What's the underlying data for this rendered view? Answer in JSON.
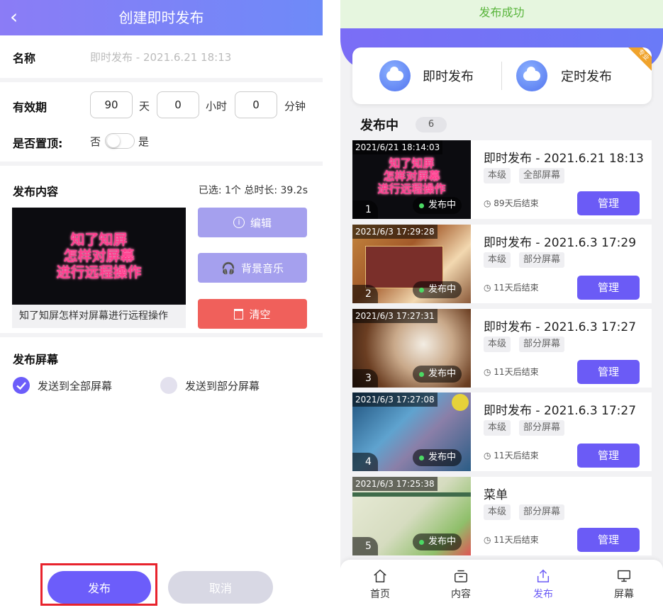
{
  "left": {
    "back_icon": "chevron-left-icon",
    "title": "创建即时发布",
    "name_label": "名称",
    "name_value": "即时发布 - 2021.6.21 18:13",
    "validity_label": "有效期",
    "days_value": "90",
    "days_unit": "天",
    "hours_value": "0",
    "hours_unit": "小时",
    "minutes_value": "0",
    "minutes_unit": "分钟",
    "pin_label": "是否置顶:",
    "pin_no": "否",
    "pin_yes": "是",
    "pin_on": false,
    "content_label": "发布内容",
    "content_summary": "已选: 1个 总时长: 39.2s",
    "content_thumb_lines": [
      "知了知屏",
      "怎样对屏幕",
      "进行远程操作"
    ],
    "content_caption": "知了知屏怎样对屏幕进行远程操作",
    "edit_label": "编辑",
    "music_label": "背景音乐",
    "clear_label": "清空",
    "screen_label": "发布屏幕",
    "send_all_label": "发送到全部屏幕",
    "send_part_label": "发送到部分屏幕",
    "send_all_selected": true,
    "publish_label": "发布",
    "cancel_label": "取消",
    "colors": {
      "accent": "#6c5dfa",
      "light_btn": "#a5a0ee",
      "danger": "#f0605b",
      "highlight": "#e8232d"
    }
  },
  "right": {
    "toast": "发布成功",
    "instant_label": "即时发布",
    "scheduled_label": "定时发布",
    "corner_badge": "专业",
    "section_title": "发布中",
    "section_count": "6",
    "cards": [
      {
        "stamp": "2021/6/21 18:14:03",
        "idx": "1",
        "status": "发布中",
        "title": "即时发布 - 2021.6.21 18:13",
        "level": "本级",
        "scope": "全部屏幕",
        "end": "89天后结束",
        "manage": "管理",
        "thumb_lines": [
          "知了知屏",
          "怎样对屏幕",
          "进行远程操作"
        ]
      },
      {
        "stamp": "2021/6/3 17:29:28",
        "idx": "2",
        "status": "发布中",
        "title": "即时发布 - 2021.6.3 17:29",
        "level": "本级",
        "scope": "部分屏幕",
        "end": "11天后结束",
        "manage": "管理"
      },
      {
        "stamp": "2021/6/3 17:27:31",
        "idx": "3",
        "status": "发布中",
        "title": "即时发布 - 2021.6.3 17:27",
        "level": "本级",
        "scope": "部分屏幕",
        "end": "11天后结束",
        "manage": "管理"
      },
      {
        "stamp": "2021/6/3 17:27:08",
        "idx": "4",
        "status": "发布中",
        "title": "即时发布 - 2021.6.3 17:27",
        "level": "本级",
        "scope": "部分屏幕",
        "end": "11天后结束",
        "manage": "管理"
      },
      {
        "stamp": "2021/6/3 17:25:38",
        "idx": "5",
        "status": "发布中",
        "title": "菜单",
        "level": "本级",
        "scope": "部分屏幕",
        "end": "11天后结束",
        "manage": "管理"
      }
    ],
    "tabs": [
      {
        "label": "首页",
        "icon": "home-icon",
        "active": false
      },
      {
        "label": "内容",
        "icon": "content-box-icon",
        "active": false
      },
      {
        "label": "发布",
        "icon": "share-upload-icon",
        "active": true
      },
      {
        "label": "屏幕",
        "icon": "monitor-icon",
        "active": false
      }
    ],
    "colors": {
      "accent": "#6b5bf6",
      "success_text": "#58b43b",
      "success_bg": "#e6f6df",
      "tab_active": "#6b5bf6"
    }
  }
}
